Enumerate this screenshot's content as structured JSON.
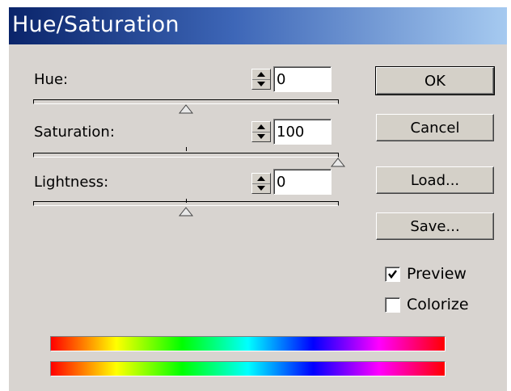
{
  "dialog": {
    "title": "Hue/Saturation",
    "colors": {
      "title_start": "#0a246a",
      "title_end": "#a6caf0",
      "face": "#d8d4d0"
    }
  },
  "hue": {
    "label": "Hue:",
    "value": "0",
    "level": 0.5
  },
  "saturation": {
    "label": "Saturation:",
    "value": "100",
    "level": 1.0
  },
  "lightness": {
    "label": "Lightness:",
    "value": "0",
    "level": 0.5
  },
  "buttons": {
    "ok": "OK",
    "cancel": "Cancel",
    "load": "Load...",
    "save": "Save..."
  },
  "options": {
    "preview": {
      "label": "Preview",
      "checked": true
    },
    "colorize": {
      "label": "Colorize",
      "checked": false
    }
  },
  "spectrum_bars": {
    "input": "input-hue-spectrum",
    "output": "output-hue-spectrum"
  }
}
